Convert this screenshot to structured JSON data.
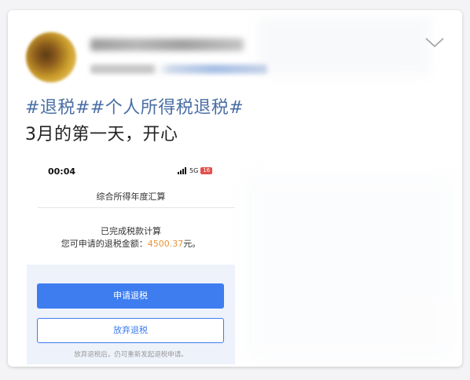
{
  "post": {
    "hashtags": "#退税##个人所得税退税#",
    "text": "3月的第一天，开心"
  },
  "screenshot": {
    "status_time": "00:04",
    "status_network": "5G",
    "status_battery": "16",
    "title": "综合所得年度汇算",
    "calc_status": "已完成税款计算",
    "refund_label": "您可申请的退税金额：",
    "refund_amount": "4500.37",
    "refund_unit": "元。",
    "apply_button": "申请退税",
    "abandon_button": "放弃退税",
    "abandon_note": "放弃退税后，仍可重新发起退税申请。"
  },
  "icons": {
    "expand": "chevron-down-icon",
    "signal": "signal-bars-icon",
    "battery": "battery-icon"
  },
  "colors": {
    "hashtag": "#4a6fa5",
    "primary_button": "#3d7df0",
    "refund_amount": "#e8933a",
    "battery_low": "#e2504c"
  }
}
